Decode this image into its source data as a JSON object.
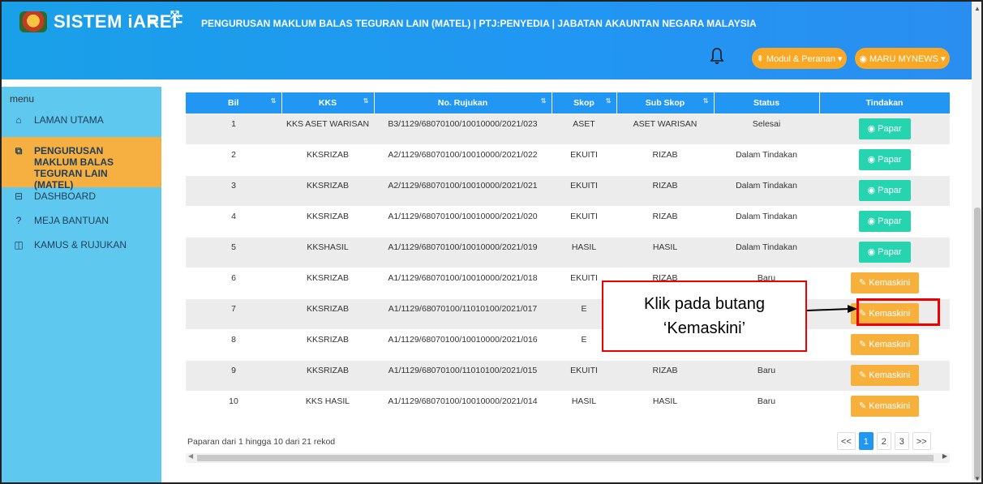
{
  "header": {
    "brand": "SISTEM iAREF",
    "burger_icon": "≡",
    "expand_icon": "⤧",
    "page_title": "PENGURUSAN MAKLUM BALAS TEGURAN LAIN (MATEL) | PTJ:PENYEDIA | JABATAN AKAUNTAN NEGARA MALAYSIA",
    "modul_button": "⇞ Modul & Peranan ▾",
    "user_button": "◉ MARU MYNEWS ▾"
  },
  "sidebar": {
    "menu_label": "menu",
    "items": [
      {
        "icon": "home-icon",
        "label": "LAMAN UTAMA"
      },
      {
        "icon": "window-icon",
        "label": "PENGURUSAN MAKLUM BALAS TEGURAN LAIN (MATEL)"
      },
      {
        "icon": "dashboard-icon",
        "label": "DASHBOARD"
      },
      {
        "icon": "question-icon",
        "label": "MEJA BANTUAN"
      },
      {
        "icon": "book-icon",
        "label": "KAMUS & RUJUKAN"
      }
    ]
  },
  "table": {
    "columns": [
      "Bil",
      "KKS",
      "No. Rujukan",
      "Skop",
      "Sub Skop",
      "Status",
      "Tindakan"
    ],
    "rows": [
      {
        "bil": "1",
        "kks": "KKS ASET WARISAN",
        "rujukan": "B3/1129/68070100/10010000/2021/023",
        "skop": "ASET",
        "subskop": "ASET WARISAN",
        "status": "Selesai",
        "action": "Papar"
      },
      {
        "bil": "2",
        "kks": "KKSRIZAB",
        "rujukan": "A2/1129/68070100/10010000/2021/022",
        "skop": "EKUITI",
        "subskop": "RIZAB",
        "status": "Dalam Tindakan",
        "action": "Papar"
      },
      {
        "bil": "3",
        "kks": "KKSRIZAB",
        "rujukan": "A2/1129/68070100/10010000/2021/021",
        "skop": "EKUITI",
        "subskop": "RIZAB",
        "status": "Dalam Tindakan",
        "action": "Papar"
      },
      {
        "bil": "4",
        "kks": "KKSRIZAB",
        "rujukan": "A1/1129/68070100/10010000/2021/020",
        "skop": "EKUITI",
        "subskop": "RIZAB",
        "status": "Dalam Tindakan",
        "action": "Papar"
      },
      {
        "bil": "5",
        "kks": "KKSHASIL",
        "rujukan": "A1/1129/68070100/10010000/2021/019",
        "skop": "HASIL",
        "subskop": "HASIL",
        "status": "Dalam Tindakan",
        "action": "Papar"
      },
      {
        "bil": "6",
        "kks": "KKSRIZAB",
        "rujukan": "A1/1129/68070100/10010000/2021/018",
        "skop": "EKUITI",
        "subskop": "RIZAB",
        "status": "Baru",
        "action": "Kemaskini"
      },
      {
        "bil": "7",
        "kks": "KKSRIZAB",
        "rujukan": "A1/1129/68070100/11010100/2021/017",
        "skop": "E",
        "subskop": "",
        "status": "",
        "action": "Kemaskini"
      },
      {
        "bil": "8",
        "kks": "KKSRIZAB",
        "rujukan": "A1/1129/68070100/10010000/2021/016",
        "skop": "E",
        "subskop": "",
        "status": "",
        "action": "Kemaskini"
      },
      {
        "bil": "9",
        "kks": "KKSRIZAB",
        "rujukan": "A1/1129/68070100/11010100/2021/015",
        "skop": "EKUITI",
        "subskop": "RIZAB",
        "status": "Baru",
        "action": "Kemaskini"
      },
      {
        "bil": "10",
        "kks": "KKS HASIL",
        "rujukan": "A1/1129/68070100/10010000/2021/014",
        "skop": "HASIL",
        "subskop": "HASIL",
        "status": "Baru",
        "action": "Kemaskini"
      }
    ]
  },
  "footer": {
    "info": "Paparan dari 1 hingga 10 dari 21 rekod",
    "pager": [
      "<<",
      "1",
      "2",
      "3",
      ">>"
    ],
    "active_page": "1"
  },
  "annotation": {
    "line1": "Klik pada butang",
    "line2": "‘Kemaskini’"
  },
  "colors": {
    "header_bg": "#2196f3",
    "sidebar_bg": "#5ec8ef",
    "active_menu": "#f6b042",
    "papar_button": "#26d4b0",
    "kemaskini_button": "#f7b03b",
    "annotation_red": "#e00000"
  }
}
